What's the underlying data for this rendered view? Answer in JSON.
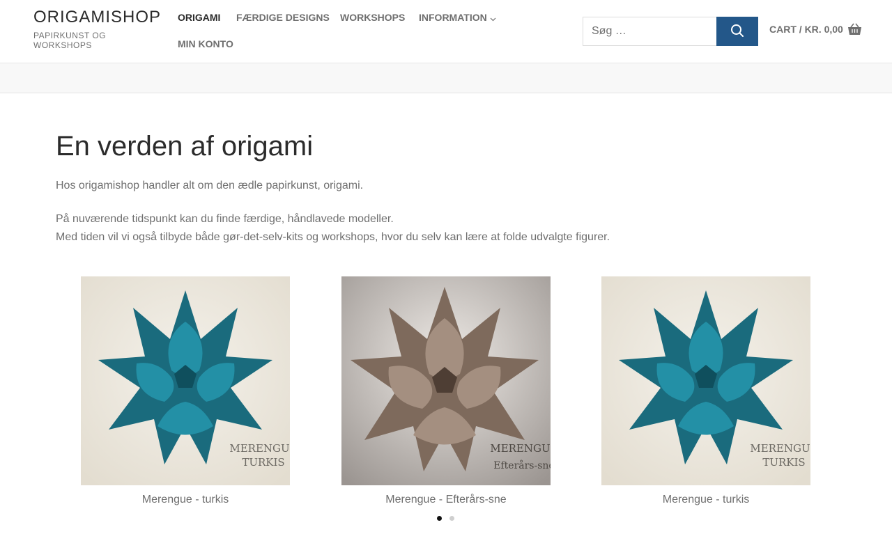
{
  "brand": {
    "title": "ORIGAMISHOP",
    "tagline": "PAPIRKUNST OG WORKSHOPS"
  },
  "nav": {
    "items": [
      {
        "label": "ORIGAMI",
        "active": true
      },
      {
        "label": "FÆRDIGE DESIGNS",
        "active": false
      },
      {
        "label": "WORKSHOPS",
        "active": false
      },
      {
        "label": "INFORMATION",
        "active": false,
        "has_dropdown": true
      },
      {
        "label": "MIN KONTO",
        "active": false
      }
    ]
  },
  "search": {
    "placeholder": "Søg …",
    "button_icon": "search-icon"
  },
  "cart": {
    "label": "CART",
    "separator": "/",
    "total": "KR. 0,00",
    "icon": "basket-icon"
  },
  "main": {
    "title": "En verden af origami",
    "intro": "Hos origamishop handler alt om den ædle papirkunst, origami.",
    "para2_line1": "På nuværende tidspunkt kan du finde færdige, håndlavede modeller.",
    "para2_line2": "Med tiden vil vi også tilbyde både gør-det-selv-kits og workshops, hvor du selv kan lære at folde udvalgte figurer."
  },
  "carousel": {
    "products": [
      {
        "name": "Merengue - turkis",
        "color": "#1f7a8c",
        "watermark_line1": "MERENGUE",
        "watermark_line2": "TURKIS"
      },
      {
        "name": "Merengue - Efterårs-sne",
        "color": "#8a7466",
        "watermark_line1": "MERENGUE",
        "watermark_line2": "Efterårs-sne"
      },
      {
        "name": "Merengue - turkis",
        "color": "#1f7a8c",
        "watermark_line1": "MERENGUE",
        "watermark_line2": "TURKIS"
      }
    ],
    "pages": 2,
    "current_page": 1
  },
  "colors": {
    "accent": "#235789",
    "text_dark": "#2b2b2b",
    "text_muted": "#6f6f6f"
  }
}
